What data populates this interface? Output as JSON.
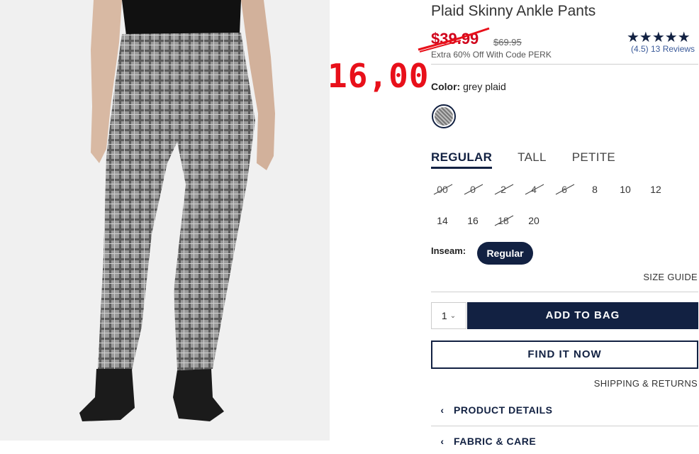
{
  "product": {
    "title": "Plaid Skinny Ankle Pants",
    "handwritten_price": "16,00",
    "sale_price": "$39.99",
    "original_price": "$69.95",
    "promo_text": "Extra 60% Off With Code PERK",
    "rating_stars": 4.5,
    "rating_text": "(4.5) 13 Reviews"
  },
  "color": {
    "label": "Color:",
    "value": "grey plaid"
  },
  "fit_tabs": [
    {
      "label": "REGULAR",
      "active": true
    },
    {
      "label": "TALL",
      "active": false
    },
    {
      "label": "PETITE",
      "active": false
    }
  ],
  "sizes": [
    {
      "label": "00",
      "available": false
    },
    {
      "label": "0",
      "available": false
    },
    {
      "label": "2",
      "available": false
    },
    {
      "label": "4",
      "available": false
    },
    {
      "label": "6",
      "available": false
    },
    {
      "label": "8",
      "available": true
    },
    {
      "label": "10",
      "available": true
    },
    {
      "label": "12",
      "available": true
    },
    {
      "label": "14",
      "available": true
    },
    {
      "label": "16",
      "available": true
    },
    {
      "label": "18",
      "available": false
    },
    {
      "label": "20",
      "available": true
    }
  ],
  "inseam": {
    "label": "Inseam:",
    "option": "Regular"
  },
  "size_guide": "SIZE GUIDE",
  "quantity": "1",
  "add_to_bag": "ADD TO BAG",
  "find_it_now": "FIND IT NOW",
  "shipping_returns": "SHIPPING & RETURNS",
  "sections": [
    {
      "label": "PRODUCT DETAILS",
      "icon": "chevron-left-icon"
    },
    {
      "label": "FABRIC & CARE",
      "icon": "chevron-left-icon"
    }
  ],
  "colors": {
    "navy": "#122142",
    "sale_red": "#d0021b",
    "handwritten_red": "#e8101a"
  }
}
